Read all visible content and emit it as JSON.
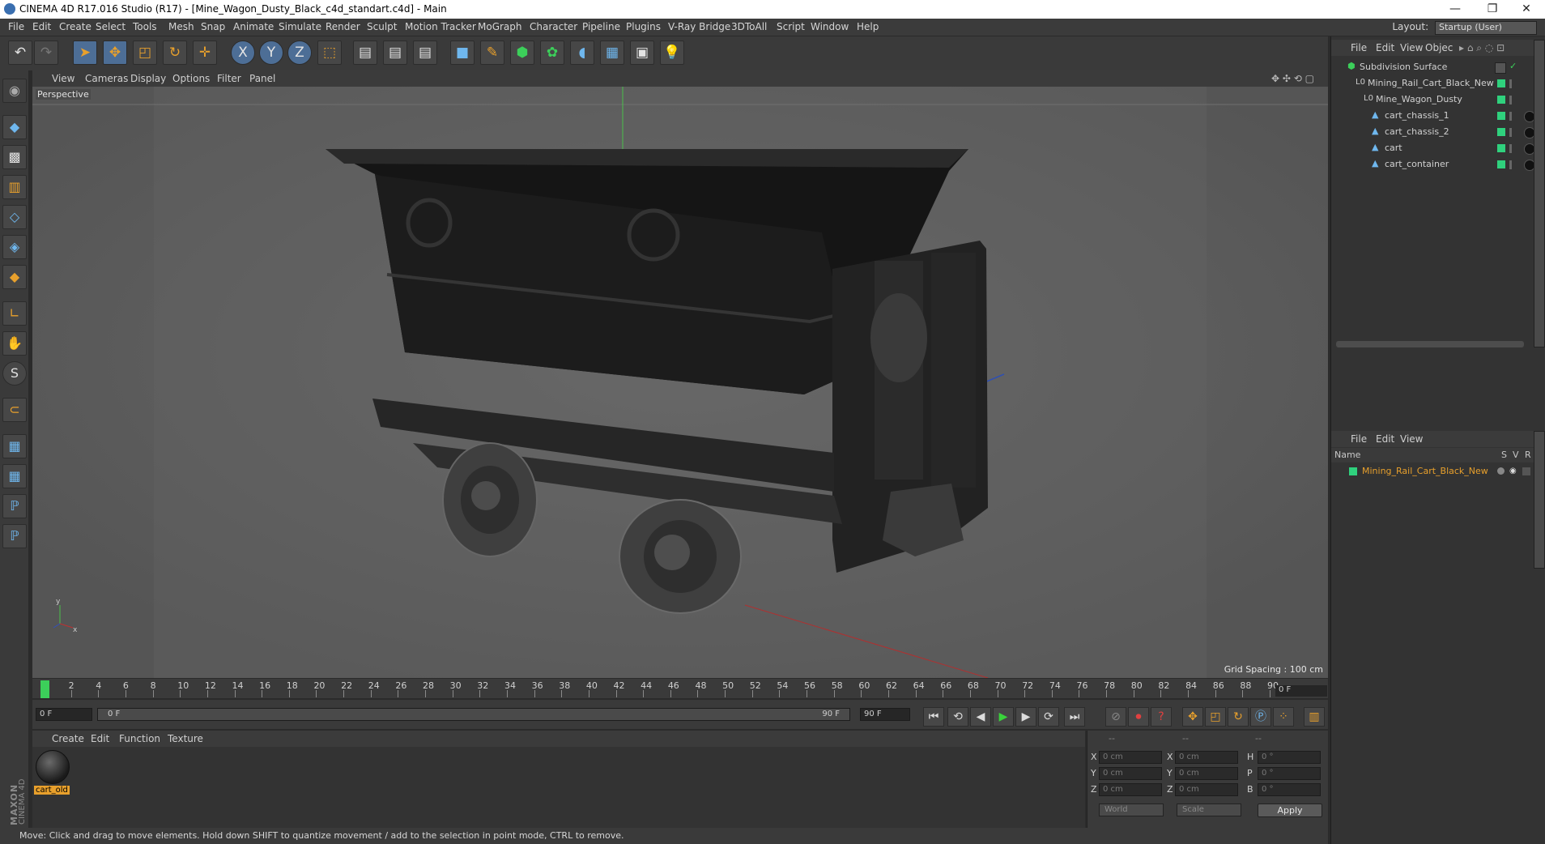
{
  "window": {
    "title": "CINEMA 4D R17.016 Studio (R17) - [Mine_Wagon_Dusty_Black_c4d_standart.c4d] - Main",
    "minimize": "—",
    "restore": "❐",
    "close": "✕"
  },
  "menubar": {
    "items": [
      "File",
      "Edit",
      "Create",
      "Select",
      "Tools",
      "Mesh",
      "Snap",
      "Animate",
      "Simulate",
      "Render",
      "Sculpt",
      "Motion Tracker",
      "MoGraph",
      "Character",
      "Pipeline",
      "Plugins",
      "V-Ray Bridge",
      "3DToAll",
      "Script",
      "Window",
      "Help"
    ],
    "layout_label": "Layout:",
    "layout_value": "Startup (User)"
  },
  "toolbar": {
    "buttons": [
      {
        "name": "undo-icon",
        "glyph": "↶"
      },
      {
        "name": "redo-icon",
        "glyph": "↷"
      },
      {
        "name": "select-arrow-icon",
        "glyph": "➤"
      },
      {
        "name": "move-icon",
        "glyph": "✥"
      },
      {
        "name": "scale-icon",
        "glyph": "◰"
      },
      {
        "name": "rotate-icon",
        "glyph": "↻"
      },
      {
        "name": "live-select-icon",
        "glyph": "✛"
      },
      {
        "name": "x-axis-icon",
        "glyph": "X"
      },
      {
        "name": "y-axis-icon",
        "glyph": "Y"
      },
      {
        "name": "z-axis-icon",
        "glyph": "Z"
      },
      {
        "name": "coordinate-system-icon",
        "glyph": "⬚"
      },
      {
        "name": "render-view-icon",
        "glyph": "▤"
      },
      {
        "name": "render-picture-viewer-icon",
        "glyph": "▤"
      },
      {
        "name": "edit-render-settings-icon",
        "glyph": "▤"
      },
      {
        "name": "cube-icon",
        "glyph": "■"
      },
      {
        "name": "pen-spline-icon",
        "glyph": "✎"
      },
      {
        "name": "subdivision-icon",
        "glyph": "⬢"
      },
      {
        "name": "array-icon",
        "glyph": "✿"
      },
      {
        "name": "deformer-icon",
        "glyph": "◖"
      },
      {
        "name": "floor-icon",
        "glyph": "▦"
      },
      {
        "name": "camera-icon",
        "glyph": "▣"
      },
      {
        "name": "light-icon",
        "glyph": "💡"
      }
    ]
  },
  "left_tools": {
    "buttons": [
      {
        "name": "model-mode-icon",
        "glyph": "◆"
      },
      {
        "name": "texture-mode-icon",
        "glyph": "▩"
      },
      {
        "name": "workplane-mode-icon",
        "glyph": "▥"
      },
      {
        "name": "points-mode-icon",
        "glyph": "◇"
      },
      {
        "name": "edges-mode-icon",
        "glyph": "◈"
      },
      {
        "name": "polygons-mode-icon",
        "glyph": "◆"
      },
      {
        "name": "axis-icon",
        "glyph": "∟"
      },
      {
        "name": "tweak-icon",
        "glyph": "✋"
      },
      {
        "name": "solo-icon",
        "glyph": "S"
      },
      {
        "name": "snap-icon",
        "glyph": "⊂"
      },
      {
        "name": "workplane-lock-icon",
        "glyph": "▦"
      },
      {
        "name": "locked-workplane-icon",
        "glyph": "▦"
      },
      {
        "name": "python-icon",
        "glyph": "ℙ"
      },
      {
        "name": "python-script-icon",
        "glyph": "ℙ"
      }
    ],
    "brand_line1": "MAXON",
    "brand_line2": "CINEMA 4D"
  },
  "viewport": {
    "menu": [
      "View",
      "Cameras",
      "Display",
      "Options",
      "Filter",
      "Panel"
    ],
    "label": "Perspective",
    "grid_spacing": "Grid Spacing : 100 cm",
    "axis_x": "x",
    "axis_y": "y"
  },
  "timeline": {
    "ticks": [
      "0",
      "2",
      "4",
      "6",
      "8",
      "10",
      "12",
      "14",
      "16",
      "18",
      "20",
      "22",
      "24",
      "26",
      "28",
      "30",
      "32",
      "34",
      "36",
      "38",
      "40",
      "42",
      "44",
      "46",
      "48",
      "50",
      "52",
      "54",
      "56",
      "58",
      "60",
      "62",
      "64",
      "66",
      "68",
      "70",
      "72",
      "74",
      "76",
      "78",
      "80",
      "82",
      "84",
      "86",
      "88",
      "90"
    ],
    "current_frame": "0 F",
    "start_frame": "0 F",
    "range_start": "0 F",
    "range_end": "90 F",
    "end_frame": "90 F"
  },
  "materials": {
    "menu": [
      "Create",
      "Edit",
      "Function",
      "Texture"
    ],
    "items": [
      {
        "label": "cart_old"
      }
    ]
  },
  "coordinates": {
    "headers": [
      "--",
      "--",
      "--"
    ],
    "rows": [
      {
        "l1": "X",
        "v1": "0 cm",
        "l2": "X",
        "v2": "0 cm",
        "l3": "H",
        "v3": "0 °"
      },
      {
        "l1": "Y",
        "v1": "0 cm",
        "l2": "Y",
        "v2": "0 cm",
        "l3": "P",
        "v3": "0 °"
      },
      {
        "l1": "Z",
        "v1": "0 cm",
        "l2": "Z",
        "v2": "0 cm",
        "l3": "B",
        "v3": "0 °"
      }
    ],
    "world": "World",
    "scale": "Scale",
    "apply": "Apply"
  },
  "status": "Move: Click and drag to move elements. Hold down SHIFT to quantize movement / add to the selection in point mode, CTRL to remove.",
  "object_manager": {
    "menu": [
      "File",
      "Edit",
      "View",
      "Objec"
    ],
    "objects": [
      {
        "label": "Subdivision Surface",
        "indent": 0
      },
      {
        "label": "Mining_Rail_Cart_Black_New",
        "indent": 1
      },
      {
        "label": "Mine_Wagon_Dusty",
        "indent": 2
      },
      {
        "label": "cart_chassis_1",
        "indent": 3
      },
      {
        "label": "cart_chassis_2",
        "indent": 3
      },
      {
        "label": "cart",
        "indent": 3
      },
      {
        "label": "cart_container",
        "indent": 3
      }
    ]
  },
  "layer_manager": {
    "menu": [
      "File",
      "Edit",
      "View"
    ],
    "col_name": "Name",
    "col_s": "S",
    "col_v": "V",
    "col_r": "R",
    "rows": [
      {
        "label": "Mining_Rail_Cart_Black_New"
      }
    ]
  },
  "colors": {
    "accent": "#e8a02c",
    "selection_blue": "#4d6e96",
    "tag_green": "#2fd17d",
    "viewport_bg": "#5a5a5a"
  }
}
